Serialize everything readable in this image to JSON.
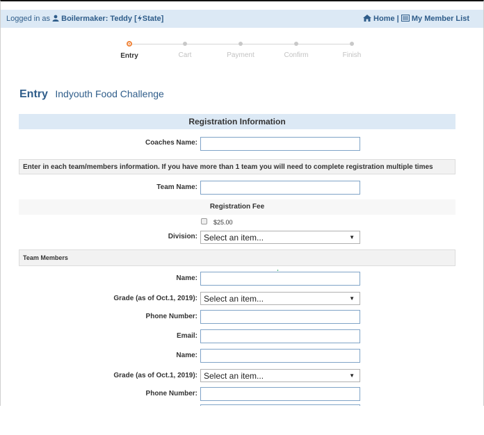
{
  "top_bar": {
    "logged_in_prefix": "Logged in as",
    "user": "Boilermaker: Teddy",
    "role_bracket_open": "[",
    "role": "State",
    "role_bracket_close": "]",
    "home_label": "Home",
    "separator": "|",
    "member_list_label": "My Member List"
  },
  "progress": {
    "steps": [
      "Entry",
      "Cart",
      "Payment",
      "Confirm",
      "Finish"
    ],
    "active_index": 0,
    "accent": "#f0843a"
  },
  "heading": {
    "title": "Entry",
    "subtitle": "Indyouth Food Challenge"
  },
  "form": {
    "section_title": "Registration Information",
    "coaches_name_label": "Coaches Name:",
    "coaches_name_value": "",
    "instructions": "Enter in each team/members information. If you have more than 1 team you will need to complete registration multiple times",
    "team_name_label": "Team Name:",
    "team_name_value": "",
    "fee_title": "Registration Fee",
    "fee_amount": "$25.00",
    "fee_checked": false,
    "division_label": "Division:",
    "division_value": "Select an item...",
    "members_title": "Team Members",
    "members": [
      {
        "name_label": "Name:",
        "grade_label": "Grade (as of Oct.1, 2019):",
        "grade_value": "Select an item...",
        "phone_label": "Phone Number:",
        "email_label": "Email:"
      },
      {
        "name_label": "Name:",
        "grade_label": "Grade (as of Oct.1, 2019):",
        "grade_value": "Select an item...",
        "phone_label": "Phone Number:"
      }
    ]
  },
  "colors": {
    "header_band": "#dce9f5",
    "link": "#2f5d8a",
    "input_border": "#7fa3c7"
  }
}
